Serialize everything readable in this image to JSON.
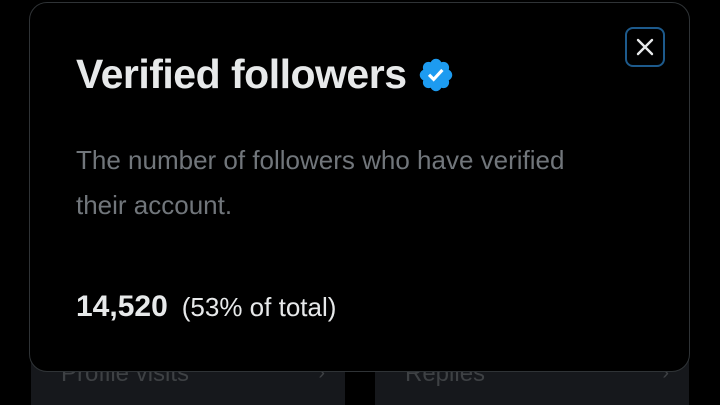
{
  "background": {
    "left_card_label": "Profile visits",
    "right_card_label": "Replies",
    "chevron": "›"
  },
  "modal": {
    "title": "Verified followers",
    "badge_icon": "verified-check-icon",
    "description": "The number of followers who have verified their account.",
    "value": "14,520",
    "share": "(53% of total)",
    "close_icon": "close-icon"
  },
  "colors": {
    "background": "#000000",
    "text_primary": "#e7e9ea",
    "text_secondary": "#71767b",
    "badge": "#1d9bf0",
    "close_focus_ring": "#1d5a8c"
  }
}
